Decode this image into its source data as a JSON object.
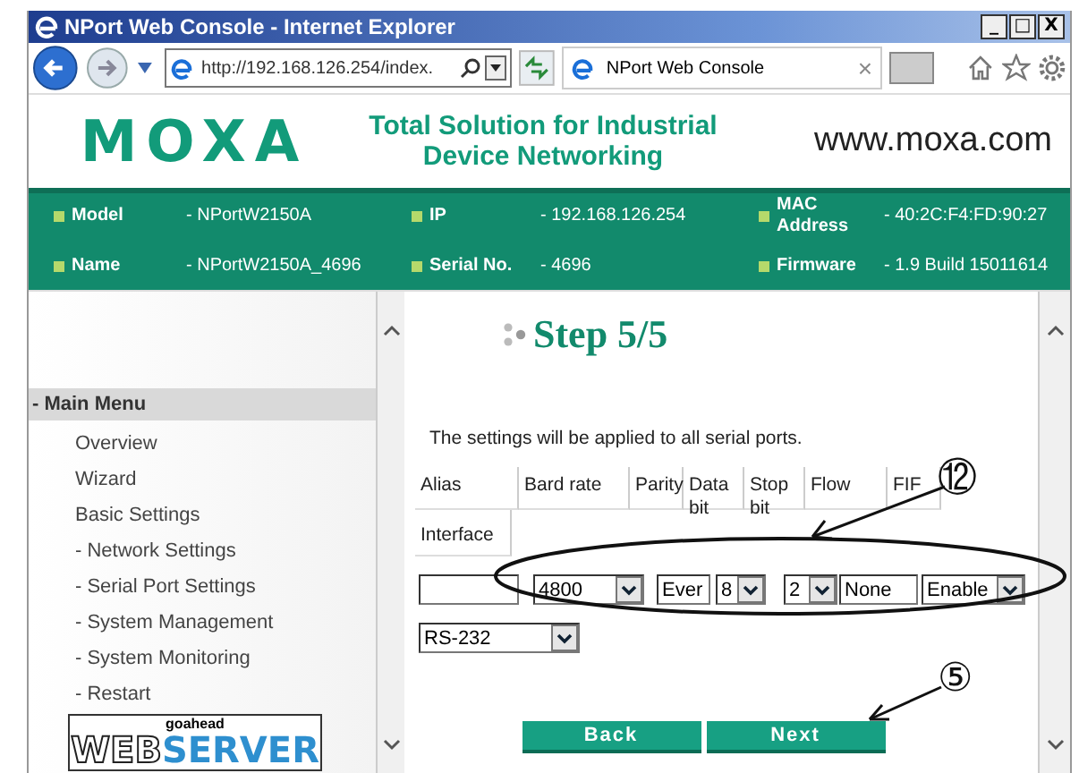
{
  "window": {
    "title": "NPort Web Console - Internet Explorer",
    "controls": [
      "_",
      "□",
      "X"
    ]
  },
  "browser": {
    "address": "http://192.168.126.254/index.",
    "tab_title": "NPort Web Console",
    "tab_close": "×"
  },
  "header": {
    "logo": "MOXA",
    "tagline": "Total Solution for Industrial Device Networking",
    "website": "www.moxa.com"
  },
  "device_info": [
    {
      "label": "Model",
      "value": "- NPortW2150A"
    },
    {
      "label": "IP",
      "value": "- 192.168.126.254"
    },
    {
      "label": "MAC Address",
      "value": "- 40:2C:F4:FD:90:27"
    },
    {
      "label": "Name",
      "value": "- NPortW2150A_4696"
    },
    {
      "label": "Serial No.",
      "value": "- 4696"
    },
    {
      "label": "Firmware",
      "value": "- 1.9 Build 15011614"
    }
  ],
  "sidebar": {
    "heading": "- Main Menu",
    "items": [
      "Overview",
      "Wizard",
      "Basic Settings",
      "- Network Settings",
      "- Serial Port Settings",
      "- System Management",
      "- System Monitoring",
      "- Restart"
    ],
    "server_logo": {
      "small": "goahead",
      "main": "WEB",
      "accent": "SERVER"
    }
  },
  "content": {
    "step": "Step 5/5",
    "note": "The settings will be applied to all serial ports.",
    "columns": [
      "Alias",
      "Bard rate",
      "Parity",
      "Data bit",
      "Stop bit",
      "Flow",
      "FIF"
    ],
    "second_header": "Interface",
    "fields": [
      {
        "kind": "text"
      },
      {
        "kind": "select",
        "value": "4800"
      },
      {
        "kind": "text",
        "value": "Ever"
      },
      {
        "kind": "select",
        "value": "8"
      },
      {
        "kind": "select",
        "value": "2"
      },
      {
        "kind": "text",
        "value": "None"
      },
      {
        "kind": "select",
        "value": "Enable"
      }
    ],
    "interface": {
      "kind": "select",
      "value": "RS-232"
    },
    "buttons": [
      "Back",
      "Next"
    ]
  },
  "annotations": [
    {
      "label": "⑫"
    },
    {
      "label": "⑤"
    }
  ]
}
